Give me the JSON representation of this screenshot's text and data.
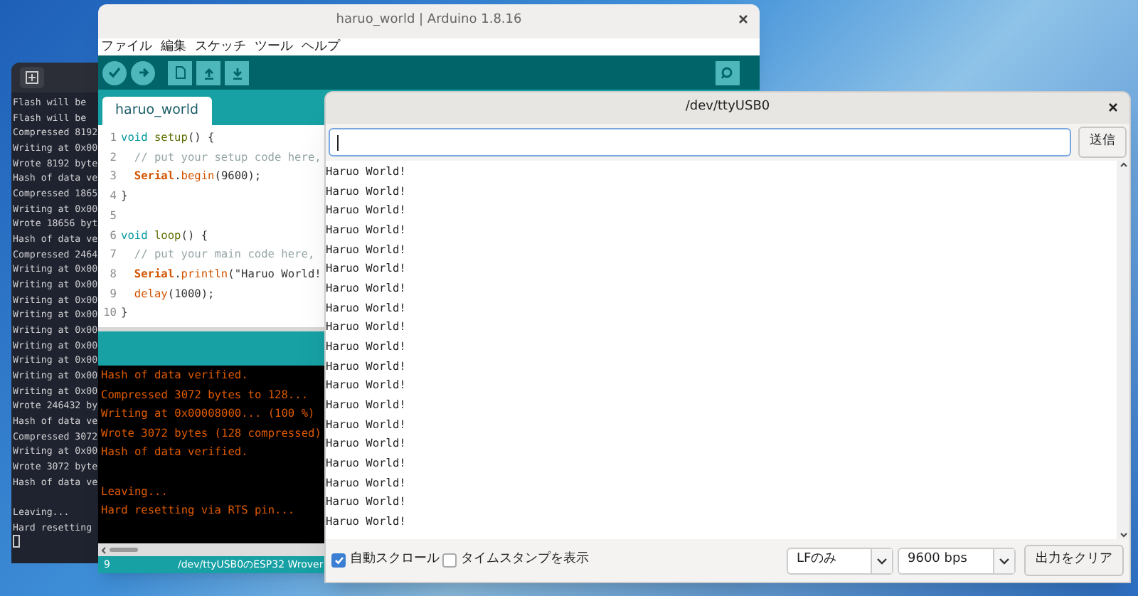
{
  "terminal": {
    "lines": [
      "Flash will be",
      "Flash will be",
      "Compressed 8192",
      "Writing at 0x00",
      "Wrote 8192 byte",
      "Hash of data ve",
      "Compressed 1865",
      "Writing at 0x00",
      "Wrote 18656 byt",
      "Hash of data ve",
      "Compressed 2464",
      "Writing at 0x00",
      "Writing at 0x00",
      "Writing at 0x00",
      "Writing at 0x00",
      "Writing at 0x00",
      "Writing at 0x00",
      "Writing at 0x00",
      "Writing at 0x00",
      "Writing at 0x00",
      "Wrote 246432 by",
      "Hash of data ve",
      "Compressed 3072",
      "Writing at 0x00",
      "Wrote 3072 byte",
      "Hash of data ve",
      {
        "kind": "blank"
      },
      "Leaving...",
      "Hard resetting"
    ]
  },
  "arduino": {
    "title": "haruo_world | Arduino 1.8.16",
    "menu": [
      "ファイル",
      "編集",
      "スケッチ",
      "ツール",
      "ヘルプ"
    ],
    "tabs": [
      {
        "label": "haruo_world",
        "selected": true
      }
    ],
    "code": [
      {
        "number": "1",
        "indented": false,
        "tokens": [
          {
            "kind": "keyword",
            "text": "void"
          },
          {
            "kind": "function",
            "text": "setup",
            "space_before": true
          },
          {
            "kind": "plain",
            "text": "() {"
          }
        ]
      },
      {
        "number": "2",
        "indented": true,
        "tokens": [
          {
            "kind": "comment",
            "text": "// put your setup code here,"
          }
        ]
      },
      {
        "number": "3",
        "indented": true,
        "tokens": [
          {
            "kind": "class",
            "text": "Serial"
          },
          {
            "kind": "plain",
            "text": "."
          },
          {
            "kind": "method",
            "text": "begin"
          },
          {
            "kind": "plain",
            "text": "(9600);"
          }
        ]
      },
      {
        "number": "4",
        "indented": false,
        "tokens": [
          {
            "kind": "plain",
            "text": "}"
          }
        ]
      },
      {
        "number": "5"
      },
      {
        "number": "6",
        "indented": false,
        "tokens": [
          {
            "kind": "keyword",
            "text": "void"
          },
          {
            "kind": "function",
            "text": "loop",
            "space_before": true
          },
          {
            "kind": "plain",
            "text": "() {"
          }
        ]
      },
      {
        "number": "7",
        "indented": true,
        "tokens": [
          {
            "kind": "comment",
            "text": "// put your main code here,"
          }
        ]
      },
      {
        "number": "8",
        "indented": true,
        "tokens": [
          {
            "kind": "class",
            "text": "Serial"
          },
          {
            "kind": "plain",
            "text": "."
          },
          {
            "kind": "method",
            "text": "println"
          },
          {
            "kind": "plain",
            "text": "(\"Haruo World!"
          }
        ]
      },
      {
        "number": "9",
        "indented": true,
        "tokens": [
          {
            "kind": "method",
            "text": "delay"
          },
          {
            "kind": "plain",
            "text": "(1000);"
          }
        ]
      },
      {
        "number": "10",
        "indented": false,
        "tokens": [
          {
            "kind": "plain",
            "text": "}"
          }
        ]
      }
    ],
    "console": [
      "Hash of data verified.",
      "Compressed 3072 bytes to 128...",
      "Writing at 0x00008000... (100 %)",
      "Wrote 3072 bytes (128 compressed)",
      "Hash of data verified.",
      {
        "kind": "blank"
      },
      "Leaving...",
      "Hard resetting via RTS pin..."
    ],
    "status": {
      "line": "9",
      "board": "/dev/ttyUSB0のESP32 Wrover"
    }
  },
  "serial_monitor": {
    "title": "/dev/ttyUSB0",
    "send_button": "送信",
    "output": [
      "Haruo World!",
      "Haruo World!",
      "Haruo World!",
      "Haruo World!",
      "Haruo World!",
      "Haruo World!",
      "Haruo World!",
      "Haruo World!",
      "Haruo World!",
      "Haruo World!",
      "Haruo World!",
      "Haruo World!",
      "Haruo World!",
      "Haruo World!",
      "Haruo World!",
      "Haruo World!",
      "Haruo World!",
      "Haruo World!",
      "Haruo World!"
    ],
    "options": [
      {
        "label": "自動スクロール",
        "checked": true
      },
      {
        "label": "タイムスタンプを表示",
        "checked": false
      }
    ],
    "line_ending": "LFのみ",
    "baud": "9600 bps",
    "clear_button": "出力をクリア"
  }
}
